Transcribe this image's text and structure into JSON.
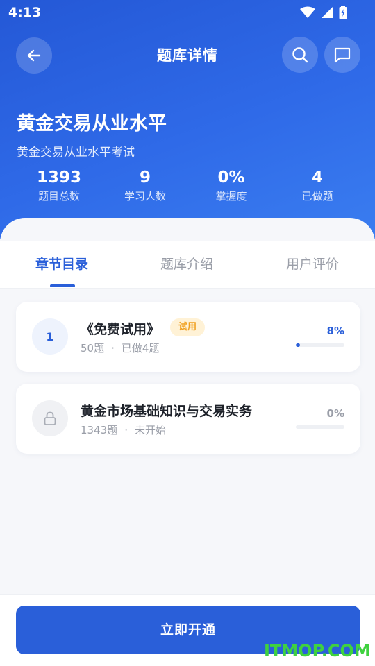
{
  "status_bar": {
    "time": "4:13"
  },
  "header": {
    "title": "题库详情"
  },
  "bank": {
    "title": "黄金交易从业水平",
    "subtitle": "黄金交易从业水平考试",
    "stats": [
      {
        "value": "1393",
        "label": "题目总数"
      },
      {
        "value": "9",
        "label": "学习人数"
      },
      {
        "value": "0%",
        "label": "掌握度"
      },
      {
        "value": "4",
        "label": "已做题"
      }
    ]
  },
  "tabs": [
    {
      "label": "章节目录",
      "active": true
    },
    {
      "label": "题库介绍",
      "active": false
    },
    {
      "label": "用户评价",
      "active": false
    }
  ],
  "chapters": [
    {
      "badge": "1",
      "title": "《免费试用》",
      "tag": "试用",
      "count": "50题",
      "separator": "·",
      "status": "已做4题",
      "percent": "8%",
      "progress": 0.08,
      "locked": false
    },
    {
      "badge": "lock-icon",
      "title": "黄金市场基础知识与交易实务",
      "count": "1343题",
      "separator": "·",
      "status": "未开始",
      "percent": "0%",
      "progress": 0,
      "locked": true
    }
  ],
  "cta": {
    "label": "立即开通"
  },
  "watermark": "ITMOP.COM",
  "colors": {
    "primary": "#2a5fd9",
    "header_gradient_start": "#2458d6",
    "header_gradient_end": "#3a7df0",
    "trial_tag_bg": "#fff2d6",
    "trial_tag_text": "#f0a020",
    "watermark": "#3fd13f"
  }
}
